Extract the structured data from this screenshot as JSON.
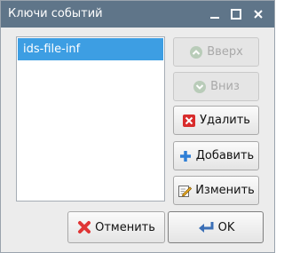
{
  "window": {
    "title": "Ключи событий",
    "title_bar_color": "#5f7589"
  },
  "list": {
    "items": [
      "ids-file-inf"
    ],
    "selected_index": 0,
    "selection_color": "#3d9ee3"
  },
  "side_buttons": {
    "up": {
      "label": "Вверх",
      "icon": "chevron-up-circle-icon",
      "enabled": false
    },
    "down": {
      "label": "Вниз",
      "icon": "chevron-down-circle-icon",
      "enabled": false
    },
    "delete": {
      "label": "Удалить",
      "icon": "red-x-icon",
      "enabled": true
    },
    "add": {
      "label": "Добавить",
      "icon": "blue-plus-icon",
      "enabled": true
    },
    "edit": {
      "label": "Изменить",
      "icon": "edit-pencil-icon",
      "enabled": true
    }
  },
  "footer": {
    "cancel": {
      "label": "Отменить",
      "icon": "red-cross-icon"
    },
    "ok": {
      "label": "OK",
      "icon": "enter-arrow-icon"
    }
  }
}
